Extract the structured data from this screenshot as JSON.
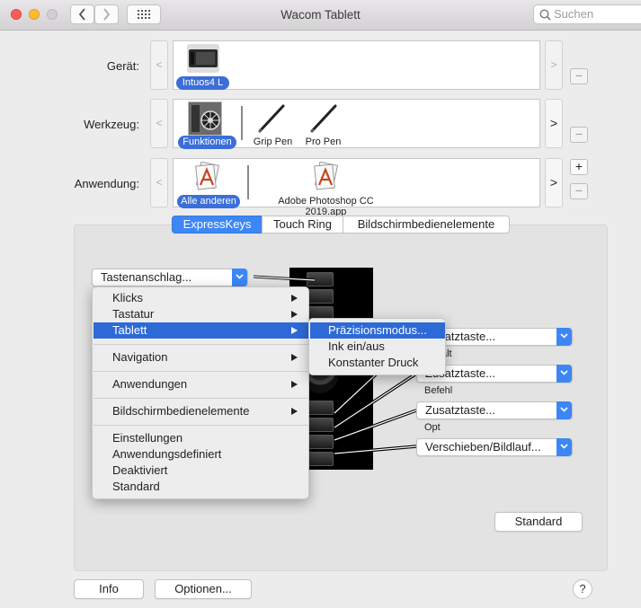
{
  "window": {
    "title": "Wacom Tablett",
    "back_label": "‹",
    "forward_label": "›",
    "search_placeholder": "Suchen"
  },
  "rows": {
    "device": {
      "label": "Gerät:",
      "items": [
        {
          "label": "Intuos4 L",
          "selected": true
        }
      ],
      "prev": "<",
      "next": ">"
    },
    "tool": {
      "label": "Werkzeug:",
      "items": [
        {
          "label": "Funktionen",
          "selected": true
        },
        {
          "label": "Grip Pen",
          "selected": false
        },
        {
          "label": "Pro Pen",
          "selected": false
        }
      ],
      "prev": "<",
      "next": ">"
    },
    "application": {
      "label": "Anwendung:",
      "items": [
        {
          "label": "Alle anderen",
          "selected": true
        },
        {
          "label": "Adobe Photoshop CC 2019.app",
          "selected": false
        }
      ],
      "prev": "<",
      "next": ">"
    },
    "add_label": "+",
    "remove_label": "−"
  },
  "tabs": [
    {
      "label": "ExpressKeys",
      "selected": true
    },
    {
      "label": "Touch Ring",
      "selected": false
    },
    {
      "label": "Bildschirmbedienelemente",
      "selected": false
    }
  ],
  "expresskeys": {
    "top_popup": "Tastenanschlag...",
    "right_popups": [
      {
        "value": "Zusatztaste...",
        "sublabel": "Schalt"
      },
      {
        "value": "Zusatztaste...",
        "sublabel": "Befehl"
      },
      {
        "value": "Zusatztaste...",
        "sublabel": "Opt"
      },
      {
        "value": "Verschieben/Bildlauf...",
        "sublabel": ""
      }
    ],
    "standard_button": "Standard"
  },
  "menu": {
    "groups": [
      [
        {
          "label": "Klicks",
          "submenu": true
        },
        {
          "label": "Tastatur",
          "submenu": true
        },
        {
          "label": "Tablett",
          "submenu": true,
          "highlighted": true
        }
      ],
      [
        {
          "label": "Navigation",
          "submenu": true
        }
      ],
      [
        {
          "label": "Anwendungen",
          "submenu": true
        }
      ],
      [
        {
          "label": "Bildschirmbedienelemente",
          "submenu": true
        }
      ],
      [
        {
          "label": "Einstellungen"
        },
        {
          "label": "Anwendungsdefiniert"
        },
        {
          "label": "Deaktiviert"
        },
        {
          "label": "Standard"
        }
      ]
    ]
  },
  "submenu": {
    "items": [
      {
        "label": "Präzisionsmodus...",
        "highlighted": true
      },
      {
        "label": "Ink ein/aus"
      },
      {
        "label": "Konstanter Druck"
      }
    ]
  },
  "footer": {
    "info_button": "Info",
    "options_button": "Optionen...",
    "help_label": "?"
  },
  "colors": {
    "accent": "#3d86f5",
    "menu_highlight": "#2d6ad8",
    "selected_pill": "#3a6ed8"
  }
}
